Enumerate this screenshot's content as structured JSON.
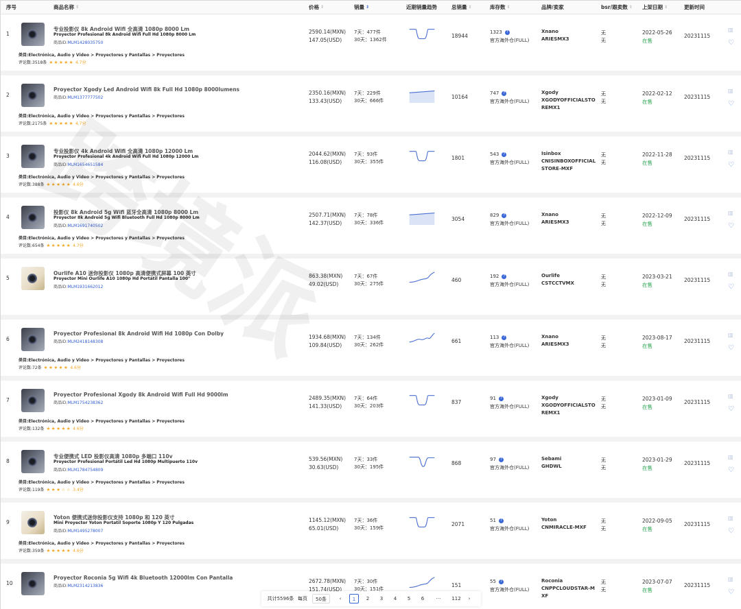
{
  "headers": {
    "idx": "序号",
    "name": "商品名称",
    "price": "价格",
    "sales": "销量",
    "trend": "近期销量趋势",
    "total": "总销量",
    "stock": "库存数",
    "brand": "品牌/卖家",
    "bsr": "bsr/跟卖数",
    "date": "上架日期",
    "updated": "更新时间"
  },
  "labels": {
    "pid_prefix": "商品ID:",
    "cat_prefix": "类目:",
    "rev_prefix": "评论数:",
    "qmark": "?"
  },
  "watermark": "跨境派",
  "rows": [
    {
      "idx": "1",
      "title": "专业投影仪 8k Android Wifi 全高清 1080p 8000 Lm",
      "subtitle": "Proyector Profesional 8k Android Wifi Full Hd 1080p 8000 Lm",
      "pid": "MLM1428035750",
      "category": "Electrónica, Audio y Video > Proyectores y Pantallas > Proyectores",
      "reviews": "3518条",
      "stars": "★★★★★",
      "score": "4.7分",
      "price_mxn": "2590.14(MXN)",
      "price_usd": "147.05(USD)",
      "sales7": "7天：477件",
      "sales30": "30天：1362件",
      "total": "18944",
      "stock": "1323",
      "warehouse": "官方海外仓(FULL)",
      "brand": "Xnano",
      "seller": "ARIESMX3",
      "bsr": "无",
      "follow": "无",
      "date": "2022-05-26",
      "status": "在售",
      "updated": "20231115",
      "spark": "dip"
    },
    {
      "idx": "2",
      "title": "Proyector Xgody Led Android Wifi 8k Full Hd 1080p 8000lumens",
      "subtitle": "",
      "pid": "MLM1377777502",
      "category": "Electrónica, Audio y Video > Proyectores y Pantallas > Proyectores",
      "reviews": "2175条",
      "stars": "★★★★★",
      "score": "4.7分",
      "price_mxn": "2350.16(MXN)",
      "price_usd": "133.43(USD)",
      "sales7": "7天：229件",
      "sales30": "30天：666件",
      "total": "10164",
      "stock": "747",
      "warehouse": "官方海外仓(FULL)",
      "brand": "Xgody",
      "seller": "XGODYOFFICIALSTOREMX1",
      "bsr": "无",
      "follow": "无",
      "date": "2022-02-12",
      "status": "在售",
      "updated": "20231115",
      "spark": "flat"
    },
    {
      "idx": "3",
      "title": "专业投影仪 4k Android Wifi 全高清 1080p 12000 Lm",
      "subtitle": "Proyector Profesional 4k Android Wifi Full Hd 1080p 12000 Lm",
      "pid": "MLM1654651584",
      "category": "Electrónica, Audio y Video > Proyectores y Pantallas > Proyectores",
      "reviews": "388条",
      "stars": "★★★★★",
      "score": "4.6分",
      "price_mxn": "2044.62(MXN)",
      "price_usd": "116.08(USD)",
      "sales7": "7天：93件",
      "sales30": "30天：355件",
      "total": "1801",
      "stock": "543",
      "warehouse": "官方海外仓(FULL)",
      "brand": "Isinbox",
      "seller": "CNISINBOXOFFICIALSTORE-MXF",
      "bsr": "无",
      "follow": "无",
      "date": "2022-11-28",
      "status": "在售",
      "updated": "20231115",
      "spark": "dip"
    },
    {
      "idx": "4",
      "title": "投影仪 8k Android 5g Wifi 蓝牙全高清 1080p 8000 Lm",
      "subtitle": "Proyector 8k Android 5g Wifi Bluetooth Full Hd 1080p 8000 Lm",
      "pid": "MLM1691740502",
      "category": "Electrónica, Audio y Video > Proyectores y Pantallas > Proyectores",
      "reviews": "654条",
      "stars": "★★★★★",
      "score": "4.7分",
      "price_mxn": "2507.71(MXN)",
      "price_usd": "142.37(USD)",
      "sales7": "7天：78件",
      "sales30": "30天：336件",
      "total": "3054",
      "stock": "829",
      "warehouse": "官方海外仓(FULL)",
      "brand": "Xnano",
      "seller": "ARIESMX3",
      "bsr": "无",
      "follow": "无",
      "date": "2022-12-09",
      "status": "在售",
      "updated": "20231115",
      "spark": "flat"
    },
    {
      "idx": "5",
      "title": "Ourlife A10 迷你投影仪 1080p 高清便携式屏幕 100 英寸",
      "subtitle": "Proyector Mini Ourlife A10 1080p Hd Portátil Pantalla 100\"",
      "pid": "MLM1931662012",
      "category": "",
      "reviews": "",
      "stars": "",
      "score": "",
      "price_mxn": "863.38(MXN)",
      "price_usd": "49.02(USD)",
      "sales7": "7天：67件",
      "sales30": "30天：275件",
      "total": "460",
      "stock": "192",
      "warehouse": "官方海外仓(FULL)",
      "brand": "Ourlife",
      "seller": "CSTCCTVMX",
      "bsr": "无",
      "follow": "无",
      "date": "2023-03-21",
      "status": "在售",
      "updated": "20231115",
      "spark": "rise"
    },
    {
      "idx": "6",
      "title": "Proyector Profesional 8k Android Wifi Hd 1080p Con Dolby",
      "subtitle": "",
      "pid": "MLM2418148308",
      "category": "Electrónica, Audio y Video > Proyectores y Pantallas > Proyectores",
      "reviews": "72条",
      "stars": "★★★★★",
      "score": "4.6分",
      "price_mxn": "1934.68(MXN)",
      "price_usd": "109.84(USD)",
      "sales7": "7天：134件",
      "sales30": "30天：262件",
      "total": "661",
      "stock": "113",
      "warehouse": "官方海外仓(FULL)",
      "brand": "Xnano",
      "seller": "ARIESMX3",
      "bsr": "无",
      "follow": "无",
      "date": "2023-08-17",
      "status": "在售",
      "updated": "20231115",
      "spark": "wave"
    },
    {
      "idx": "7",
      "title": "Proyector Profesional Xgody 8k Android Wifi Full Hd 9000lm",
      "subtitle": "",
      "pid": "MLM1754238362",
      "category": "Electrónica, Audio y Video > Proyectores y Pantallas > Proyectores",
      "reviews": "132条",
      "stars": "★★★★★",
      "score": "4.6分",
      "price_mxn": "2489.35(MXN)",
      "price_usd": "141.33(USD)",
      "sales7": "7天：64件",
      "sales30": "30天：203件",
      "total": "837",
      "stock": "91",
      "warehouse": "官方海外仓(FULL)",
      "brand": "Xgody",
      "seller": "XGODYOFFICIALSTOREMX1",
      "bsr": "无",
      "follow": "无",
      "date": "2023-01-09",
      "status": "在售",
      "updated": "20231115",
      "spark": "dip"
    },
    {
      "idx": "8",
      "title": "专业便携式 LED 投影仪高清 1080p 多端口 110v",
      "subtitle": "Proyector Profesional Portátil Led Hd 1080p Multipuerto 110v",
      "pid": "MLM1784754809",
      "category": "Electrónica, Audio y Video > Proyectores y Pantallas > Proyectores",
      "reviews": "119条",
      "stars": "★★★☆☆",
      "score": "3.4分",
      "price_mxn": "539.56(MXN)",
      "price_usd": "30.63(USD)",
      "sales7": "7天：33件",
      "sales30": "30天：195件",
      "total": "868",
      "stock": "97",
      "warehouse": "官方海外仓(FULL)",
      "brand": "Sebami",
      "seller": "GHDWL",
      "bsr": "无",
      "follow": "无",
      "date": "2023-01-29",
      "status": "在售",
      "updated": "20231115",
      "spark": "vdip"
    },
    {
      "idx": "9",
      "title": "Yoton 便携式迷你投影仪支持 1080p 和 120 英寸",
      "subtitle": "Mini Proyector Yoton Portatil Soporte 1080p Y 120 Pulgadas",
      "pid": "MLM1495278007",
      "category": "Electrónica, Audio y Video > Proyectores y Pantallas > Proyectores",
      "reviews": "359条",
      "stars": "★★★★★",
      "score": "4.6分",
      "price_mxn": "1145.12(MXN)",
      "price_usd": "65.01(USD)",
      "sales7": "7天：36件",
      "sales30": "30天：159件",
      "total": "2071",
      "stock": "51",
      "warehouse": "官方海外仓(FULL)",
      "brand": "Yoton",
      "seller": "CNMIRACLE-MXF",
      "bsr": "无",
      "follow": "无",
      "date": "2022-09-05",
      "status": "在售",
      "updated": "20231115",
      "spark": "dip"
    },
    {
      "idx": "10",
      "title": "Proyector Roconia 5g Wifi 4k Bluetooth 12000lm Con Pantalla",
      "subtitle": "",
      "pid": "MLM2314213836",
      "category": "",
      "reviews": "",
      "stars": "",
      "score": "",
      "price_mxn": "2672.78(MXN)",
      "price_usd": "151.74(USD)",
      "sales7": "7天：30件",
      "sales30": "30天：151件",
      "total": "151",
      "stock": "55",
      "warehouse": "官方海外仓(FULL)",
      "brand": "Roconia",
      "seller": "CNPPCLOUDSTAR-MXF",
      "bsr": "无",
      "follow": "无",
      "date": "2023-07-07",
      "status": "在售",
      "updated": "20231115",
      "spark": "rise"
    }
  ],
  "pagination": {
    "total": "共计5596条",
    "per_page_label": "每页",
    "per_page": "50条",
    "prev": "‹",
    "next": "›",
    "pages": [
      "1",
      "2",
      "3",
      "4",
      "5",
      "6",
      "···",
      "112"
    ],
    "current": "1"
  }
}
